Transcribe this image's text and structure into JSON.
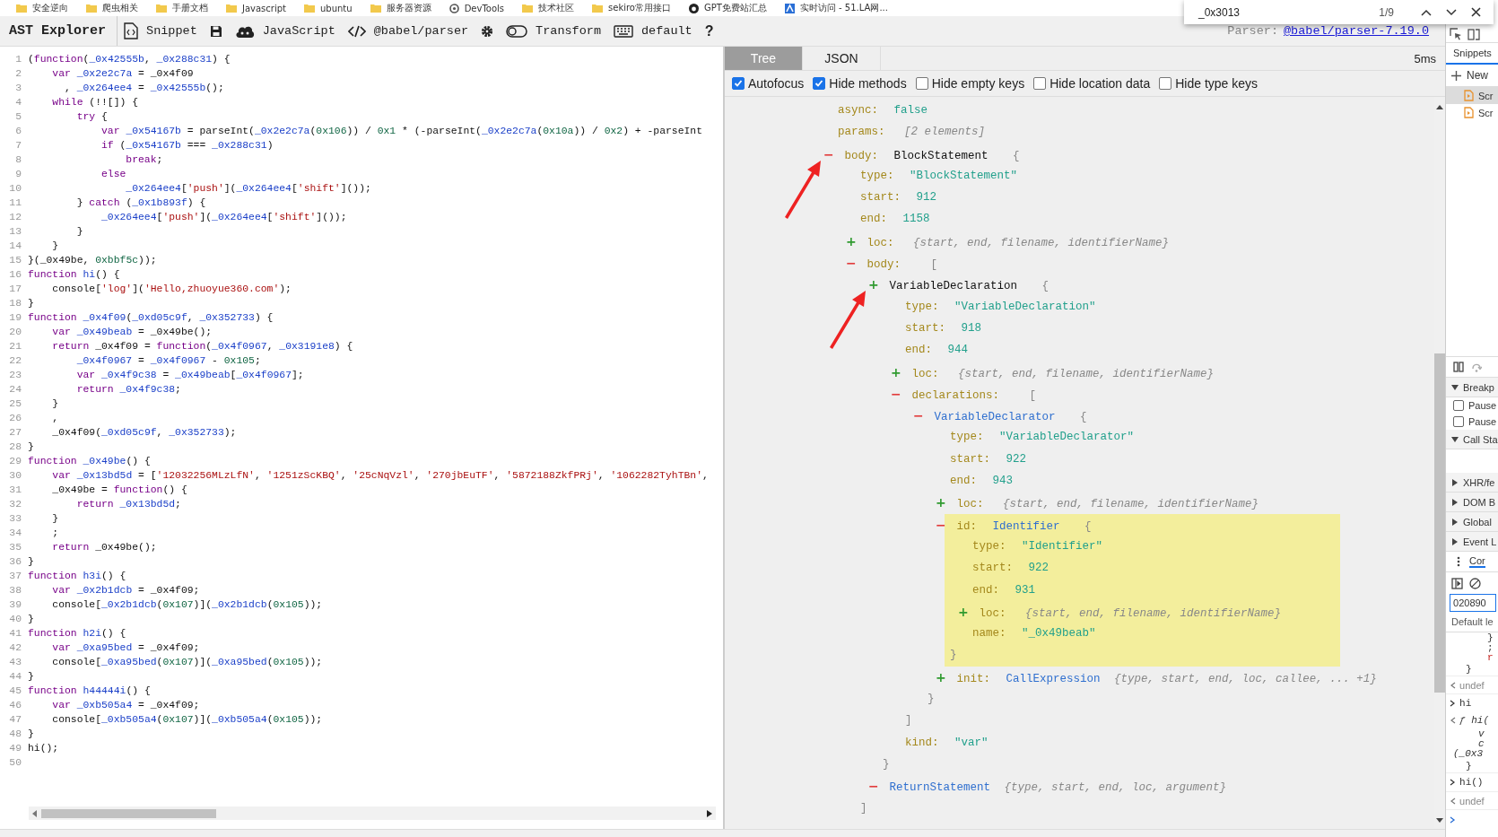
{
  "bookmarks": [
    {
      "kind": "folder",
      "label": "安全逆向"
    },
    {
      "kind": "folder",
      "label": "爬虫相关"
    },
    {
      "kind": "folder",
      "label": "手册文档"
    },
    {
      "kind": "folder",
      "label": "Javascript"
    },
    {
      "kind": "folder",
      "label": "ubuntu"
    },
    {
      "kind": "folder",
      "label": "服务器资源"
    },
    {
      "kind": "devtools",
      "label": "DevTools"
    },
    {
      "kind": "folder",
      "label": "技术社区"
    },
    {
      "kind": "folder",
      "label": "sekiro常用接口"
    },
    {
      "kind": "github",
      "label": "GPT免费站汇总"
    },
    {
      "kind": "site",
      "label": "实时访问 - 51.LA网..."
    }
  ],
  "find_bar": {
    "value": "_0x3013",
    "count": "1/9"
  },
  "toolbar": {
    "title": "AST Explorer",
    "items": [
      {
        "kind": "snippet",
        "label": "Snippet"
      },
      {
        "kind": "save"
      },
      {
        "kind": "language",
        "label": "JavaScript"
      },
      {
        "kind": "parser",
        "label": "@babel/parser"
      },
      {
        "kind": "settings"
      },
      {
        "kind": "transform",
        "label": "Transform"
      },
      {
        "kind": "keymap",
        "label": "default"
      },
      {
        "kind": "help",
        "label": "?"
      }
    ],
    "parser_label": "Parser:",
    "parser_link": "@babel/parser-7.19.0"
  },
  "code": {
    "lines": [
      {
        "number": "1",
        "tokens": [
          {
            "kind": "text",
            "text": "("
          },
          {
            "kind": "keyword",
            "text": "function"
          },
          {
            "kind": "text",
            "text": "("
          },
          {
            "kind": "name",
            "text": "_0x42555b"
          },
          {
            "kind": "text",
            "text": ", "
          },
          {
            "kind": "name",
            "text": "_0x288c31"
          },
          {
            "kind": "text",
            "text": ") {"
          }
        ]
      },
      {
        "number": "2",
        "tokens": [
          {
            "kind": "keyword",
            "text": "    var"
          },
          {
            "kind": "name",
            "text": " _0x2e2c7a"
          },
          {
            "kind": "text",
            "text": " = _0x4f09"
          }
        ]
      },
      {
        "number": "3",
        "tokens": [
          {
            "kind": "text",
            "text": "      , "
          },
          {
            "kind": "name",
            "text": "_0x264ee4"
          },
          {
            "kind": "text",
            "text": " = "
          },
          {
            "kind": "name",
            "text": "_0x42555b"
          },
          {
            "kind": "text",
            "text": "();"
          }
        ]
      },
      {
        "number": "4",
        "tokens": [
          {
            "kind": "keyword",
            "text": "    while"
          },
          {
            "kind": "text",
            "text": " (!![]) {"
          }
        ]
      },
      {
        "number": "5",
        "tokens": [
          {
            "kind": "keyword",
            "text": "        try"
          },
          {
            "kind": "text",
            "text": " {"
          }
        ]
      },
      {
        "number": "6",
        "tokens": [
          {
            "kind": "keyword",
            "text": "            var"
          },
          {
            "kind": "name",
            "text": " _0x54167b"
          },
          {
            "kind": "text",
            "text": " = parseInt("
          },
          {
            "kind": "name",
            "text": "_0x2e2c7a"
          },
          {
            "kind": "text",
            "text": "("
          },
          {
            "kind": "number",
            "text": "0x106"
          },
          {
            "kind": "text",
            "text": ")) / "
          },
          {
            "kind": "number",
            "text": "0x1"
          },
          {
            "kind": "text",
            "text": " * (-parseInt("
          },
          {
            "kind": "name",
            "text": "_0x2e2c7a"
          },
          {
            "kind": "text",
            "text": "("
          },
          {
            "kind": "number",
            "text": "0x10a"
          },
          {
            "kind": "text",
            "text": ")) / "
          },
          {
            "kind": "number",
            "text": "0x2"
          },
          {
            "kind": "text",
            "text": ") + -parseInt"
          }
        ]
      },
      {
        "number": "7",
        "tokens": [
          {
            "kind": "keyword",
            "text": "            if"
          },
          {
            "kind": "text",
            "text": " ("
          },
          {
            "kind": "name",
            "text": "_0x54167b"
          },
          {
            "kind": "text",
            "text": " === "
          },
          {
            "kind": "name",
            "text": "_0x288c31"
          },
          {
            "kind": "text",
            "text": ")"
          }
        ]
      },
      {
        "number": "8",
        "tokens": [
          {
            "kind": "keyword",
            "text": "                break"
          },
          {
            "kind": "text",
            "text": ";"
          }
        ]
      },
      {
        "number": "9",
        "tokens": [
          {
            "kind": "keyword",
            "text": "            else"
          }
        ]
      },
      {
        "number": "10",
        "tokens": [
          {
            "kind": "name",
            "text": "                _0x264ee4"
          },
          {
            "kind": "text",
            "text": "["
          },
          {
            "kind": "string",
            "text": "'push'"
          },
          {
            "kind": "text",
            "text": "]("
          },
          {
            "kind": "name",
            "text": "_0x264ee4"
          },
          {
            "kind": "text",
            "text": "["
          },
          {
            "kind": "string",
            "text": "'shift'"
          },
          {
            "kind": "text",
            "text": "]());"
          }
        ]
      },
      {
        "number": "11",
        "tokens": [
          {
            "kind": "text",
            "text": "        } "
          },
          {
            "kind": "keyword",
            "text": "catch"
          },
          {
            "kind": "text",
            "text": " ("
          },
          {
            "kind": "name",
            "text": "_0x1b893f"
          },
          {
            "kind": "text",
            "text": ") {"
          }
        ]
      },
      {
        "number": "12",
        "tokens": [
          {
            "kind": "name",
            "text": "            _0x264ee4"
          },
          {
            "kind": "text",
            "text": "["
          },
          {
            "kind": "string",
            "text": "'push'"
          },
          {
            "kind": "text",
            "text": "]("
          },
          {
            "kind": "name",
            "text": "_0x264ee4"
          },
          {
            "kind": "text",
            "text": "["
          },
          {
            "kind": "string",
            "text": "'shift'"
          },
          {
            "kind": "text",
            "text": "]());"
          }
        ]
      },
      {
        "number": "13",
        "tokens": [
          {
            "kind": "text",
            "text": "        }"
          }
        ]
      },
      {
        "number": "14",
        "tokens": [
          {
            "kind": "text",
            "text": "    }"
          }
        ]
      },
      {
        "number": "15",
        "tokens": [
          {
            "kind": "text",
            "text": "}(_0x49be, "
          },
          {
            "kind": "number",
            "text": "0xbbf5c"
          },
          {
            "kind": "text",
            "text": "));"
          }
        ]
      },
      {
        "number": "16",
        "tokens": [
          {
            "kind": "keyword",
            "text": "function"
          },
          {
            "kind": "name",
            "text": " hi"
          },
          {
            "kind": "text",
            "text": "() {"
          }
        ]
      },
      {
        "number": "17",
        "tokens": [
          {
            "kind": "text",
            "text": "    console["
          },
          {
            "kind": "string",
            "text": "'log'"
          },
          {
            "kind": "text",
            "text": "]("
          },
          {
            "kind": "string",
            "text": "'Hello,zhuoyue360.com'"
          },
          {
            "kind": "text",
            "text": ");"
          }
        ]
      },
      {
        "number": "18",
        "tokens": [
          {
            "kind": "text",
            "text": "}"
          }
        ]
      },
      {
        "number": "19",
        "tokens": [
          {
            "kind": "keyword",
            "text": "function"
          },
          {
            "kind": "name",
            "text": " _0x4f09"
          },
          {
            "kind": "text",
            "text": "("
          },
          {
            "kind": "name",
            "text": "_0xd05c9f"
          },
          {
            "kind": "text",
            "text": ", "
          },
          {
            "kind": "name",
            "text": "_0x352733"
          },
          {
            "kind": "text",
            "text": ") {"
          }
        ]
      },
      {
        "number": "20",
        "tokens": [
          {
            "kind": "keyword",
            "text": "    var"
          },
          {
            "kind": "name",
            "text": " _0x49beab"
          },
          {
            "kind": "text",
            "text": " = _0x49be();"
          }
        ]
      },
      {
        "number": "21",
        "tokens": [
          {
            "kind": "keyword",
            "text": "    return"
          },
          {
            "kind": "text",
            "text": " _0x4f09 = "
          },
          {
            "kind": "keyword",
            "text": "function"
          },
          {
            "kind": "text",
            "text": "("
          },
          {
            "kind": "name",
            "text": "_0x4f0967"
          },
          {
            "kind": "text",
            "text": ", "
          },
          {
            "kind": "name",
            "text": "_0x3191e8"
          },
          {
            "kind": "text",
            "text": ") {"
          }
        ]
      },
      {
        "number": "22",
        "tokens": [
          {
            "kind": "name",
            "text": "        _0x4f0967"
          },
          {
            "kind": "text",
            "text": " = "
          },
          {
            "kind": "name",
            "text": "_0x4f0967"
          },
          {
            "kind": "text",
            "text": " - "
          },
          {
            "kind": "number",
            "text": "0x105"
          },
          {
            "kind": "text",
            "text": ";"
          }
        ]
      },
      {
        "number": "23",
        "tokens": [
          {
            "kind": "keyword",
            "text": "        var"
          },
          {
            "kind": "name",
            "text": " _0x4f9c38"
          },
          {
            "kind": "text",
            "text": " = "
          },
          {
            "kind": "name",
            "text": "_0x49beab"
          },
          {
            "kind": "text",
            "text": "["
          },
          {
            "kind": "name",
            "text": "_0x4f0967"
          },
          {
            "kind": "text",
            "text": "];"
          }
        ]
      },
      {
        "number": "24",
        "tokens": [
          {
            "kind": "keyword",
            "text": "        return"
          },
          {
            "kind": "name",
            "text": " _0x4f9c38"
          },
          {
            "kind": "text",
            "text": ";"
          }
        ]
      },
      {
        "number": "25",
        "tokens": [
          {
            "kind": "text",
            "text": "    }"
          }
        ]
      },
      {
        "number": "26",
        "tokens": [
          {
            "kind": "text",
            "text": "    ,"
          }
        ]
      },
      {
        "number": "27",
        "tokens": [
          {
            "kind": "text",
            "text": "    _0x4f09("
          },
          {
            "kind": "name",
            "text": "_0xd05c9f"
          },
          {
            "kind": "text",
            "text": ", "
          },
          {
            "kind": "name",
            "text": "_0x352733"
          },
          {
            "kind": "text",
            "text": ");"
          }
        ]
      },
      {
        "number": "28",
        "tokens": [
          {
            "kind": "text",
            "text": "}"
          }
        ]
      },
      {
        "number": "29",
        "tokens": [
          {
            "kind": "keyword",
            "text": "function"
          },
          {
            "kind": "name",
            "text": " _0x49be"
          },
          {
            "kind": "text",
            "text": "() {"
          }
        ]
      },
      {
        "number": "30",
        "tokens": [
          {
            "kind": "keyword",
            "text": "    var"
          },
          {
            "kind": "name",
            "text": " _0x13bd5d"
          },
          {
            "kind": "text",
            "text": " = ["
          },
          {
            "kind": "string",
            "text": "'12032256MLzLfN'"
          },
          {
            "kind": "text",
            "text": ", "
          },
          {
            "kind": "string",
            "text": "'1251zScKBQ'"
          },
          {
            "kind": "text",
            "text": ", "
          },
          {
            "kind": "string",
            "text": "'25cNqVzl'"
          },
          {
            "kind": "text",
            "text": ", "
          },
          {
            "kind": "string",
            "text": "'270jbEuTF'"
          },
          {
            "kind": "text",
            "text": ", "
          },
          {
            "kind": "string",
            "text": "'5872188ZkfPRj'"
          },
          {
            "kind": "text",
            "text": ", "
          },
          {
            "kind": "string",
            "text": "'1062282TyhTBn'"
          },
          {
            "kind": "text",
            "text": ","
          }
        ]
      },
      {
        "number": "31",
        "tokens": [
          {
            "kind": "text",
            "text": "    _0x49be = "
          },
          {
            "kind": "keyword",
            "text": "function"
          },
          {
            "kind": "text",
            "text": "() {"
          }
        ]
      },
      {
        "number": "32",
        "tokens": [
          {
            "kind": "keyword",
            "text": "        return"
          },
          {
            "kind": "name",
            "text": " _0x13bd5d"
          },
          {
            "kind": "text",
            "text": ";"
          }
        ]
      },
      {
        "number": "33",
        "tokens": [
          {
            "kind": "text",
            "text": "    }"
          }
        ]
      },
      {
        "number": "34",
        "tokens": [
          {
            "kind": "text",
            "text": "    ;"
          }
        ]
      },
      {
        "number": "35",
        "tokens": [
          {
            "kind": "keyword",
            "text": "    return"
          },
          {
            "kind": "text",
            "text": " _0x49be();"
          }
        ]
      },
      {
        "number": "36",
        "tokens": [
          {
            "kind": "text",
            "text": "}"
          }
        ]
      },
      {
        "number": "37",
        "tokens": [
          {
            "kind": "keyword",
            "text": "function"
          },
          {
            "kind": "name",
            "text": " h3i"
          },
          {
            "kind": "text",
            "text": "() {"
          }
        ]
      },
      {
        "number": "38",
        "tokens": [
          {
            "kind": "keyword",
            "text": "    var"
          },
          {
            "kind": "name",
            "text": " _0x2b1dcb"
          },
          {
            "kind": "text",
            "text": " = _0x4f09;"
          }
        ]
      },
      {
        "number": "39",
        "tokens": [
          {
            "kind": "text",
            "text": "    console["
          },
          {
            "kind": "name",
            "text": "_0x2b1dcb"
          },
          {
            "kind": "text",
            "text": "("
          },
          {
            "kind": "number",
            "text": "0x107"
          },
          {
            "kind": "text",
            "text": ")]("
          },
          {
            "kind": "name",
            "text": "_0x2b1dcb"
          },
          {
            "kind": "text",
            "text": "("
          },
          {
            "kind": "number",
            "text": "0x105"
          },
          {
            "kind": "text",
            "text": "));"
          }
        ]
      },
      {
        "number": "40",
        "tokens": [
          {
            "kind": "text",
            "text": "}"
          }
        ]
      },
      {
        "number": "41",
        "tokens": [
          {
            "kind": "keyword",
            "text": "function"
          },
          {
            "kind": "name",
            "text": " h2i"
          },
          {
            "kind": "text",
            "text": "() {"
          }
        ]
      },
      {
        "number": "42",
        "tokens": [
          {
            "kind": "keyword",
            "text": "    var"
          },
          {
            "kind": "name",
            "text": " _0xa95bed"
          },
          {
            "kind": "text",
            "text": " = _0x4f09;"
          }
        ]
      },
      {
        "number": "43",
        "tokens": [
          {
            "kind": "text",
            "text": "    console["
          },
          {
            "kind": "name",
            "text": "_0xa95bed"
          },
          {
            "kind": "text",
            "text": "("
          },
          {
            "kind": "number",
            "text": "0x107"
          },
          {
            "kind": "text",
            "text": ")]("
          },
          {
            "kind": "name",
            "text": "_0xa95bed"
          },
          {
            "kind": "text",
            "text": "("
          },
          {
            "kind": "number",
            "text": "0x105"
          },
          {
            "kind": "text",
            "text": "));"
          }
        ]
      },
      {
        "number": "44",
        "tokens": [
          {
            "kind": "text",
            "text": "}"
          }
        ]
      },
      {
        "number": "45",
        "tokens": [
          {
            "kind": "keyword",
            "text": "function"
          },
          {
            "kind": "name",
            "text": " h44444i"
          },
          {
            "kind": "text",
            "text": "() {"
          }
        ]
      },
      {
        "number": "46",
        "tokens": [
          {
            "kind": "keyword",
            "text": "    var"
          },
          {
            "kind": "name",
            "text": " _0xb505a4"
          },
          {
            "kind": "text",
            "text": " = _0x4f09;"
          }
        ]
      },
      {
        "number": "47",
        "tokens": [
          {
            "kind": "text",
            "text": "    console["
          },
          {
            "kind": "name",
            "text": "_0xb505a4"
          },
          {
            "kind": "text",
            "text": "("
          },
          {
            "kind": "number",
            "text": "0x107"
          },
          {
            "kind": "text",
            "text": ")]("
          },
          {
            "kind": "name",
            "text": "_0xb505a4"
          },
          {
            "kind": "text",
            "text": "("
          },
          {
            "kind": "number",
            "text": "0x105"
          },
          {
            "kind": "text",
            "text": "));"
          }
        ]
      },
      {
        "number": "48",
        "tokens": [
          {
            "kind": "text",
            "text": "}"
          }
        ]
      },
      {
        "number": "49",
        "tokens": [
          {
            "kind": "text",
            "text": "hi();"
          }
        ]
      },
      {
        "number": "50"
      }
    ]
  },
  "tree": {
    "tabs": [
      {
        "label": "Tree",
        "selected": true
      },
      {
        "label": "JSON",
        "selected": false
      }
    ],
    "time": "5ms",
    "options": [
      {
        "label": "Autofocus",
        "checked": true
      },
      {
        "label": "Hide methods",
        "checked": true
      },
      {
        "label": "Hide empty keys",
        "checked": false
      },
      {
        "label": "Hide location data",
        "checked": false
      },
      {
        "label": "Hide type keys",
        "checked": false
      }
    ],
    "nodes": [
      {
        "key": "async:",
        "value": "false"
      },
      {
        "key": "params:",
        "summary": "[2 elements]"
      },
      {
        "toggle": {
          "symbol": "−",
          "color": "#e23b3b"
        },
        "key": "body:",
        "type_name": "BlockStatement",
        "plain_type": true,
        "pointed": true,
        "open": "{",
        "children": [
          {
            "key": "type:",
            "value": "\"BlockStatement\""
          },
          {
            "key": "start:",
            "value": "912"
          },
          {
            "key": "end:",
            "value": "1158"
          },
          {
            "toggle": {
              "symbol": "+",
              "color": "#2f9a2f"
            },
            "key": "loc:",
            "summary": "{start, end, filename, identifierName}"
          },
          {
            "toggle": {
              "symbol": "−",
              "color": "#e23b3b"
            },
            "key": "body:",
            "open": "[",
            "children": [
              {
                "toggle": {
                  "symbol": "+",
                  "color": "#2f9a2f"
                },
                "type_name": "VariableDeclaration",
                "plain_type": true,
                "pointed": true,
                "open": "{",
                "children": [
                  {
                    "key": "type:",
                    "value": "\"VariableDeclaration\""
                  },
                  {
                    "key": "start:",
                    "value": "918"
                  },
                  {
                    "key": "end:",
                    "value": "944"
                  },
                  {
                    "toggle": {
                      "symbol": "+",
                      "color": "#2f9a2f"
                    },
                    "key": "loc:",
                    "summary": "{start, end, filename, identifierName}"
                  },
                  {
                    "toggle": {
                      "symbol": "−",
                      "color": "#e23b3b"
                    },
                    "key": "declarations:",
                    "open": "[",
                    "children": [
                      {
                        "toggle": {
                          "symbol": "−",
                          "color": "#e23b3b"
                        },
                        "type_name": "VariableDeclarator",
                        "plain_type": false,
                        "pointed": false,
                        "open": "{",
                        "children": [
                          {
                            "key": "type:",
                            "value": "\"VariableDeclarator\"",
                            "highlighted": false
                          },
                          {
                            "key": "start:",
                            "value": "922",
                            "highlighted": false
                          },
                          {
                            "key": "end:",
                            "value": "943",
                            "highlighted": false
                          },
                          {
                            "toggle": {
                              "symbol": "+",
                              "color": "#2f9a2f"
                            },
                            "key": "loc:",
                            "summary": "{start, end, filename, identifierName}",
                            "highlighted": false
                          },
                          {
                            "toggle": {
                              "symbol": "−",
                              "color": "#e23b3b"
                            },
                            "key": "id:",
                            "type_name": "Identifier",
                            "plain_type": false,
                            "highlighted": true,
                            "open": "{",
                            "children": [
                              {
                                "key": "type:",
                                "value": "\"Identifier\""
                              },
                              {
                                "key": "start:",
                                "value": "922"
                              },
                              {
                                "key": "end:",
                                "value": "931"
                              },
                              {
                                "toggle": {
                                  "symbol": "+",
                                  "color": "#2f9a2f"
                                },
                                "key": "loc:",
                                "summary": "{start, end, filename, identifierName}"
                              },
                              {
                                "key": "name:",
                                "value": "\"_0x49beab\""
                              }
                            ],
                            "close": "}"
                          },
                          {
                            "toggle": {
                              "symbol": "+",
                              "color": "#2f9a2f"
                            },
                            "key": "init:",
                            "type_name": "CallExpression",
                            "plain_type": false,
                            "summary": "{type, start, end, loc, callee, ... +1}",
                            "highlighted": false
                          }
                        ],
                        "close": "}"
                      }
                    ],
                    "close": "]"
                  },
                  {
                    "key": "kind:",
                    "value": "\"var\""
                  }
                ],
                "close": "}"
              },
              {
                "toggle": {
                  "symbol": "−",
                  "color": "#e23b3b"
                },
                "type_name": "ReturnStatement",
                "plain_type": false,
                "pointed": false,
                "summary": "{type, start, end, loc, argument}"
              }
            ],
            "close": "]"
          }
        ]
      }
    ]
  },
  "devtools": {
    "tab": "Snippets",
    "new_label": "New",
    "files": [
      {
        "name": "Scr",
        "selected": true
      },
      {
        "name": "Scr",
        "selected": false
      }
    ],
    "panes": [
      {
        "label": "Breakp",
        "expanded": true,
        "checkboxes": [
          {
            "label": "Pause",
            "checked": false
          },
          {
            "label": "Pause",
            "checked": false
          }
        ]
      },
      {
        "label": "Call Sta",
        "expanded": true
      },
      {
        "label": "XHR/fe",
        "expanded": false
      },
      {
        "label": "DOM B",
        "expanded": false
      },
      {
        "label": "Global",
        "expanded": false
      },
      {
        "label": "Event L",
        "expanded": false
      }
    ],
    "console_tab": "Cor",
    "filter_value": "020890",
    "level_label": "Default le",
    "console_lines": [
      {
        "kind": "tail",
        "text": "}"
      },
      {
        "kind": "tail",
        "text": ";"
      },
      {
        "kind": "string",
        "text": "r"
      },
      {
        "kind": "brace",
        "text": "}"
      },
      {
        "kind": "result",
        "text": "undef"
      },
      {
        "kind": "input",
        "text": "hi"
      },
      {
        "kind": "function",
        "text": "ƒ hi("
      },
      {
        "kind": "body",
        "text": "v"
      },
      {
        "kind": "body",
        "text": "c"
      },
      {
        "kind": "lead",
        "text": "(_0x3"
      },
      {
        "kind": "brace",
        "text": "}"
      },
      {
        "kind": "input",
        "text": "hi()"
      },
      {
        "kind": "result",
        "text": "undef"
      },
      {
        "kind": "prompt"
      }
    ]
  }
}
